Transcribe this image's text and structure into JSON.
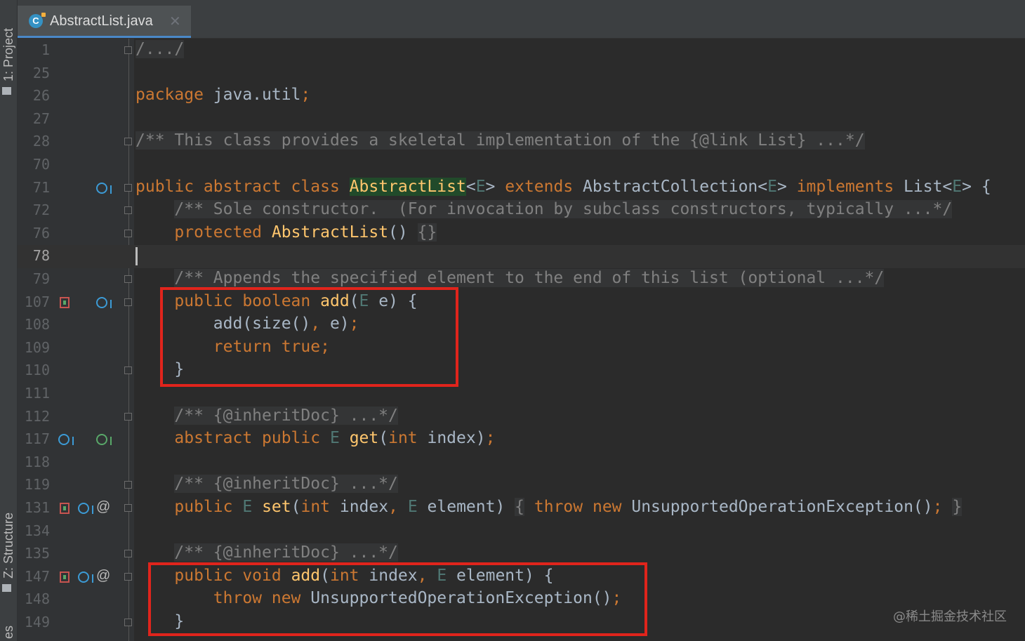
{
  "side_tabs": {
    "project": "1: Project",
    "structure": "Z: Structure",
    "bottom": "es"
  },
  "tab": {
    "file_name": "AbstractList.java",
    "icon_letter": "C"
  },
  "current_line": "78",
  "lines": [
    {
      "n": "1",
      "html": "<span class=\"cm\">/.../</span>",
      "fold": true
    },
    {
      "n": "25",
      "html": ""
    },
    {
      "n": "26",
      "html": "<span class=\"kw\">package</span> java.util<span class=\"kw\">;</span>"
    },
    {
      "n": "27",
      "html": ""
    },
    {
      "n": "28",
      "html": "<span class=\"cm\">/** This class provides a skeletal implementation of the {@link List} ...*/</span>",
      "fold": true
    },
    {
      "n": "70",
      "html": ""
    },
    {
      "n": "71",
      "html": "<span class=\"kw\">public abstract class</span> <span class=\"hl\">AbstractList</span>&lt;<span class=\"tp\">E</span>&gt; <span class=\"kw\">extends</span> AbstractCollection&lt;<span class=\"tp\">E</span>&gt; <span class=\"kw\">implements</span> List&lt;<span class=\"tp\">E</span>&gt; {",
      "fold": true,
      "icons": [
        "ovr-down"
      ]
    },
    {
      "n": "72",
      "html": "    <span class=\"cm\">/** Sole constructor.  (For invocation by subclass constructors, typically ...*/</span>",
      "fold": true
    },
    {
      "n": "76",
      "html": "    <span class=\"kw\">protected</span> <span class=\"fn\">AbstractList</span>() <span class=\"cm\">{}</span>",
      "fold": true
    },
    {
      "n": "78",
      "html": ""
    },
    {
      "n": "79",
      "html": "    <span class=\"cm\">/** Appends the specified element to the end of this list (optional ...*/</span>",
      "fold": true
    },
    {
      "n": "107",
      "html": "    <span class=\"kw\">public boolean</span> <span class=\"fn\">add</span>(<span class=\"tp\">E</span> e) {",
      "fold": true,
      "icons": [
        "impl",
        "ovr-down"
      ]
    },
    {
      "n": "108",
      "html": "        add(size()<span class=\"kw\">,</span> e)<span class=\"kw\">;</span>"
    },
    {
      "n": "109",
      "html": "        <span class=\"kw\">return true;</span>"
    },
    {
      "n": "110",
      "html": "    }",
      "fold": true
    },
    {
      "n": "111",
      "html": ""
    },
    {
      "n": "112",
      "html": "    <span class=\"cm\">/** {@inheritDoc} ...*/</span>",
      "fold": true
    },
    {
      "n": "117",
      "html": "    <span class=\"kw\">abstract public</span> <span class=\"tp\">E</span> <span class=\"fn\">get</span>(<span class=\"kw\">int</span> index)<span class=\"kw\">;</span>",
      "icons": [
        "ovr-up",
        "ovr-down-green"
      ]
    },
    {
      "n": "118",
      "html": ""
    },
    {
      "n": "119",
      "html": "    <span class=\"cm\">/** {@inheritDoc} ...*/</span>",
      "fold": true
    },
    {
      "n": "131",
      "html": "    <span class=\"kw\">public</span> <span class=\"tp\">E</span> <span class=\"fn\">set</span>(<span class=\"kw\">int</span> index<span class=\"kw\">,</span> <span class=\"tp\">E</span> element) <span class=\"cm\">{</span> <span class=\"kw\">throw new</span> UnsupportedOperationException()<span class=\"kw\">;</span> <span class=\"cm\">}</span>",
      "fold": true,
      "icons": [
        "impl",
        "ovr-down",
        "at"
      ]
    },
    {
      "n": "134",
      "html": ""
    },
    {
      "n": "135",
      "html": "    <span class=\"cm\">/** {@inheritDoc} ...*/</span>",
      "fold": true
    },
    {
      "n": "147",
      "html": "    <span class=\"kw\">public void</span> <span class=\"fn\">add</span>(<span class=\"kw\">int</span> index<span class=\"kw\">,</span> <span class=\"tp\">E</span> element) {",
      "fold": true,
      "icons": [
        "impl",
        "ovr-down",
        "at"
      ]
    },
    {
      "n": "148",
      "html": "        <span class=\"kw\">throw new</span> UnsupportedOperationException()<span class=\"kw\">;</span>"
    },
    {
      "n": "149",
      "html": "    }",
      "fold": true
    }
  ],
  "watermark": "@稀土掘金技术社区",
  "colors": {
    "keyword": "#cc7832",
    "method": "#ffc66d",
    "comment": "#808080",
    "type_param": "#507874",
    "highlight_bg": "#214a2a",
    "annotation_box": "#e0241c"
  }
}
